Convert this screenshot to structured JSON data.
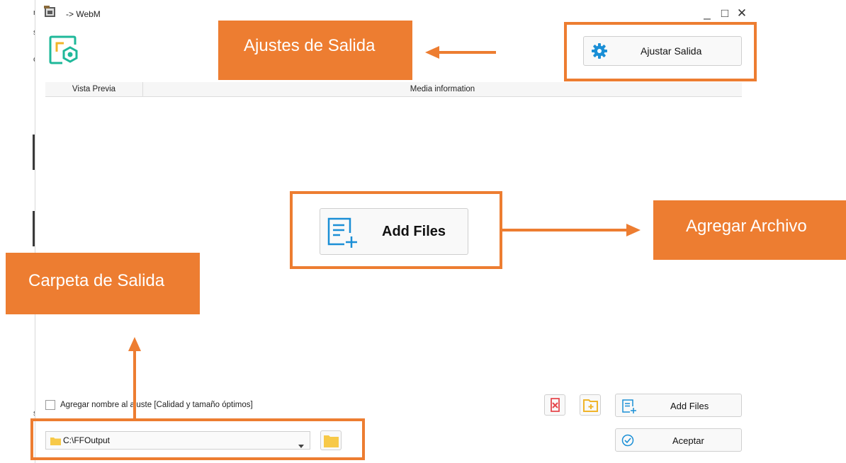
{
  "window": {
    "title": "-> WebM",
    "minimize_glyph": "_",
    "maximize_glyph": "□",
    "close_glyph": "✕"
  },
  "top_button": {
    "label": "Ajustar Salida",
    "icon": "gear-icon"
  },
  "table": {
    "col_preview": "Vista Previa",
    "col_info": "Media information"
  },
  "center_button": {
    "label": "Add Files",
    "icon": "add-file-icon"
  },
  "options": {
    "checkbox_label": "Agregar nombre al ajuste [Calidad y tamaño óptimos]",
    "checked": false
  },
  "toolbar": {
    "remove_icon": "remove-file-icon",
    "add_folder_icon": "add-folder-icon",
    "add_files_label": "Add Files",
    "accept_label": "Aceptar"
  },
  "output": {
    "path": "C:\\FFOutput"
  },
  "annotations": {
    "ajustes": "Ajustes de Salida",
    "agregar": "Agregar Archivo",
    "carpeta": "Carpeta de Salida"
  },
  "colors": {
    "annotation": "#ed7d31",
    "icon_blue": "#1b8fd6",
    "icon_teal": "#1fb89a",
    "folder_yellow": "#f7c948",
    "remove_red": "#e5484d"
  }
}
